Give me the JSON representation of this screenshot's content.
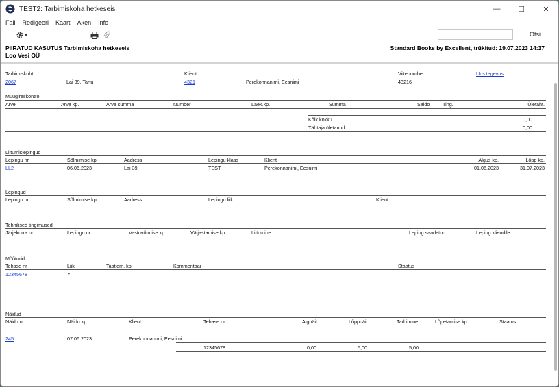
{
  "window": {
    "title": "TEST2: Tarbimiskoha hetkeseis",
    "controls": {
      "minimize": "—",
      "maximize": "☐",
      "close": "✕"
    }
  },
  "menu": [
    "Fail",
    "Redigeeri",
    "Kaart",
    "Aken",
    "Info"
  ],
  "toolbar": {
    "search_button": "Otsi",
    "search_value": ""
  },
  "report_header": {
    "line1": "PIIRATUD KASUTUS Tarbimiskoha hetkeseis",
    "line2": "Loo Vesi OÜ",
    "right": "Standard Books by Excellent, trükitud: 19.07.2023 14:37"
  },
  "top": {
    "labels": {
      "tarbimiskoht": "Tarbimiskoht",
      "klient": "Klient",
      "viitenumber": "Viitenumber",
      "uus_tegevus": "Uus tegevus"
    },
    "values": {
      "tarbimiskoht": "2067",
      "address": "Lai 39, Tartu",
      "klient_code": "4321",
      "klient_name": "Perekonnanimi, Eesnimi",
      "viitenumber": "43216"
    }
  },
  "muugireskontro": {
    "title": "Müügireskontro",
    "headers": [
      "Arve",
      "Arve kp.",
      "Arve summa",
      "Number",
      "Laek.kp.",
      "Summa",
      "Saldo",
      "Ting.",
      "Ületäht."
    ],
    "summary": [
      {
        "label": "Kõik kokku",
        "value": "0,00"
      },
      {
        "label": "Tähtaja ületanud",
        "value": "0,00"
      }
    ]
  },
  "liitumislepingud": {
    "title": "Liitumislepingud",
    "headers": [
      "Lepingu nr",
      "Sõlmimise kp",
      "Aadress",
      "Lepingu klass",
      "Klient",
      "Algus kp.",
      "Lõpp kp."
    ],
    "row": {
      "nr": "LL2",
      "date": "06.06.2023",
      "address": "Lai 39",
      "klass": "TEST",
      "klient": "Perekonnanimi, Eesnimi",
      "algus": "01.06.2023",
      "lopp": "31.07.2023"
    }
  },
  "lepingud": {
    "title": "Lepingud",
    "headers": [
      "Lepingu nr",
      "Sõlmimise kp",
      "Aadress",
      "Lepingu liik",
      "Klient"
    ]
  },
  "tehnilised": {
    "title": "Tehnilised tingimused",
    "headers": [
      "Järjekorra nr.",
      "Lepingu nr.",
      "Vastuvõtmise kp.",
      "Väljastamise kp.",
      "Liitumine",
      "Leping saadetud",
      "Leping kliendile"
    ]
  },
  "mooturid": {
    "title": "Mõõturid",
    "headers": [
      "Tehase nr",
      "Liik",
      "Taatlem. kp",
      "Kommentaar",
      "Staatus"
    ],
    "row": {
      "tehase_nr": "12345678",
      "liik": "Y"
    }
  },
  "naidud": {
    "title": "Näidud",
    "headers": [
      "Näidu nr.",
      "Näidu kp.",
      "Klient",
      "Tehase nr",
      "Algnäit",
      "Lõppnäit",
      "Tarbimine",
      "Lõpetamise kp",
      "Staatus"
    ],
    "row": {
      "nr": "245",
      "kp": "07.06.2023",
      "klient": "Perekonnanimi, Eesnimi"
    },
    "subrow": {
      "tehase_nr": "12345678",
      "algnait": "0,00",
      "loppnait": "5,00",
      "tarbimine": "5,00"
    }
  }
}
